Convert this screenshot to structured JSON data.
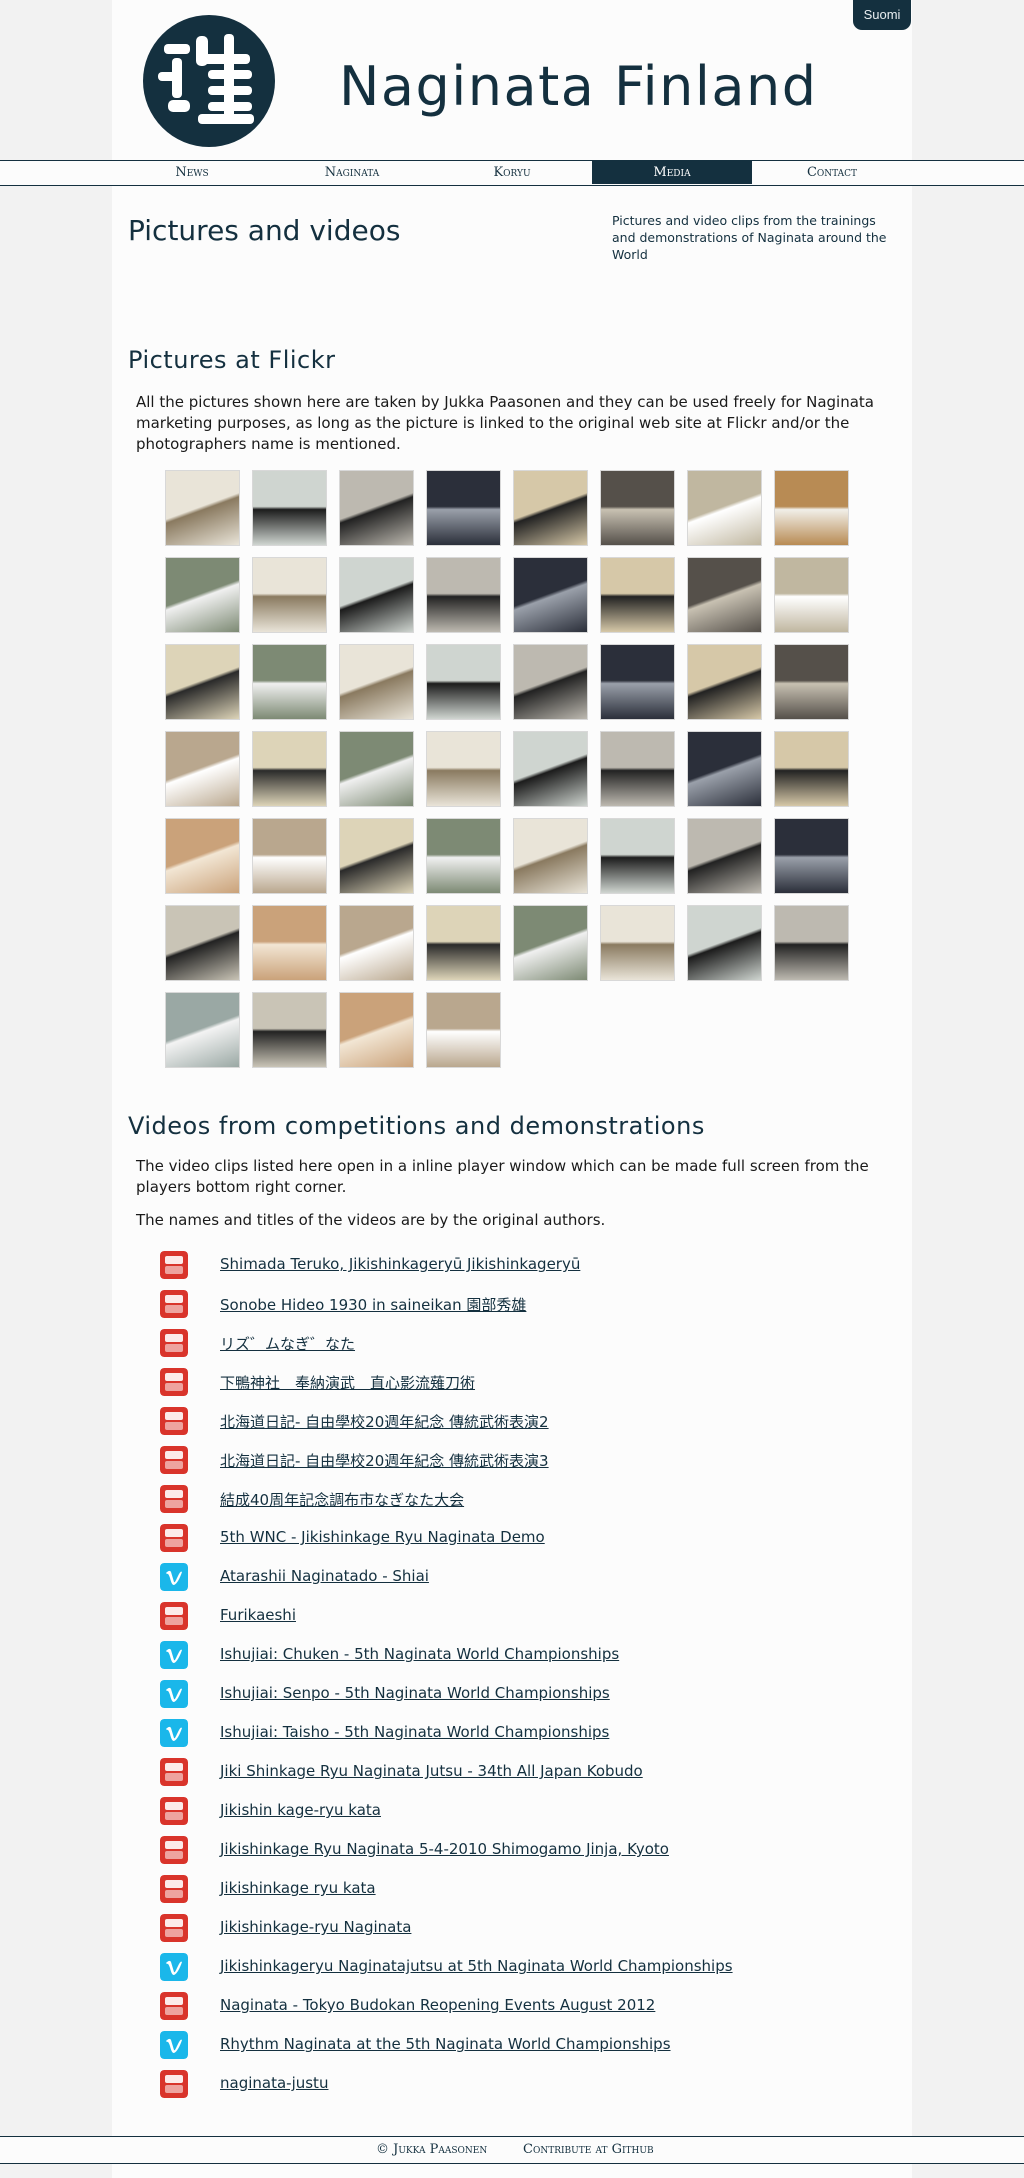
{
  "lang_button": "Suomi",
  "site_title": "Naginata Finland",
  "nav": [
    {
      "label": "News"
    },
    {
      "label": "Naginata"
    },
    {
      "label": "Koryu"
    },
    {
      "label": "Media",
      "active": true
    },
    {
      "label": "Contact"
    }
  ],
  "page_title": "Pictures and videos",
  "intro": "Pictures and video clips from the trainings and demonstrations of Naginata around the World",
  "flickr": {
    "heading": "Pictures at Flickr",
    "text": "All the pictures shown here are taken by Jukka Paasonen and they can be used freely for Naginata marketing purposes, as long as the picture is linked to the original web site at Flickr and/or the photographers name is mentioned.",
    "photo_count": 52
  },
  "videos": {
    "heading": "Videos from competitions and demonstrations",
    "text1": "The video clips listed here open in a inline player window which can be made full screen from the players bottom right corner.",
    "text2": "The names and titles of the videos are by the original authors.",
    "items": [
      {
        "title": "Shimada Teruko, Jikishinkageryū Jikishinkageryū",
        "source": "youtube"
      },
      {
        "title": "Sonobe Hideo 1930 in saineikan 園部秀雄",
        "source": "youtube"
      },
      {
        "title": "リズ゛ムなぎ゛なた",
        "source": "youtube"
      },
      {
        "title": "下鴨神社　奉納演武　直心影流薙刀術",
        "source": "youtube"
      },
      {
        "title": "北海道日記- 自由學校20週年紀念 傳統武術表演2",
        "source": "youtube"
      },
      {
        "title": "北海道日記- 自由學校20週年紀念 傳統武術表演3",
        "source": "youtube"
      },
      {
        "title": "結成40周年記念調布市なぎなた大会",
        "source": "youtube"
      },
      {
        "title": "5th WNC - Jikishinkage Ryu Naginata Demo",
        "source": "youtube"
      },
      {
        "title": "Atarashii Naginatado - Shiai",
        "source": "vimeo"
      },
      {
        "title": "Furikaeshi",
        "source": "youtube"
      },
      {
        "title": "Ishujiai: Chuken - 5th Naginata World Championships",
        "source": "vimeo"
      },
      {
        "title": "Ishujiai: Senpo - 5th Naginata World Championships",
        "source": "vimeo"
      },
      {
        "title": "Ishujiai: Taisho - 5th Naginata World Championships",
        "source": "vimeo"
      },
      {
        "title": "Jiki Shinkage Ryu Naginata Jutsu - 34th All Japan Kobudo",
        "source": "youtube"
      },
      {
        "title": "Jikishin kage-ryu kata",
        "source": "youtube"
      },
      {
        "title": "Jikishinkage Ryu Naginata 5-4-2010 Shimogamo Jinja, Kyoto",
        "source": "youtube"
      },
      {
        "title": "Jikishinkage ryu kata",
        "source": "youtube"
      },
      {
        "title": "Jikishinkage-ryu Naginata",
        "source": "youtube"
      },
      {
        "title": "Jikishinkageryu Naginatajutsu at 5th Naginata World Championships",
        "source": "vimeo"
      },
      {
        "title": "Naginata - Tokyo Budokan Reopening Events August 2012",
        "source": "youtube"
      },
      {
        "title": "Rhythm Naginata at the 5th Naginata World Championships",
        "source": "vimeo"
      },
      {
        "title": "naginata-justu",
        "source": "youtube"
      }
    ]
  },
  "footer": {
    "copyright": "© Jukka Paasonen",
    "github": "Contribute at Github"
  },
  "colors": {
    "brand": "#14303f",
    "youtube": "#d9342b",
    "vimeo": "#1ab7ea"
  }
}
